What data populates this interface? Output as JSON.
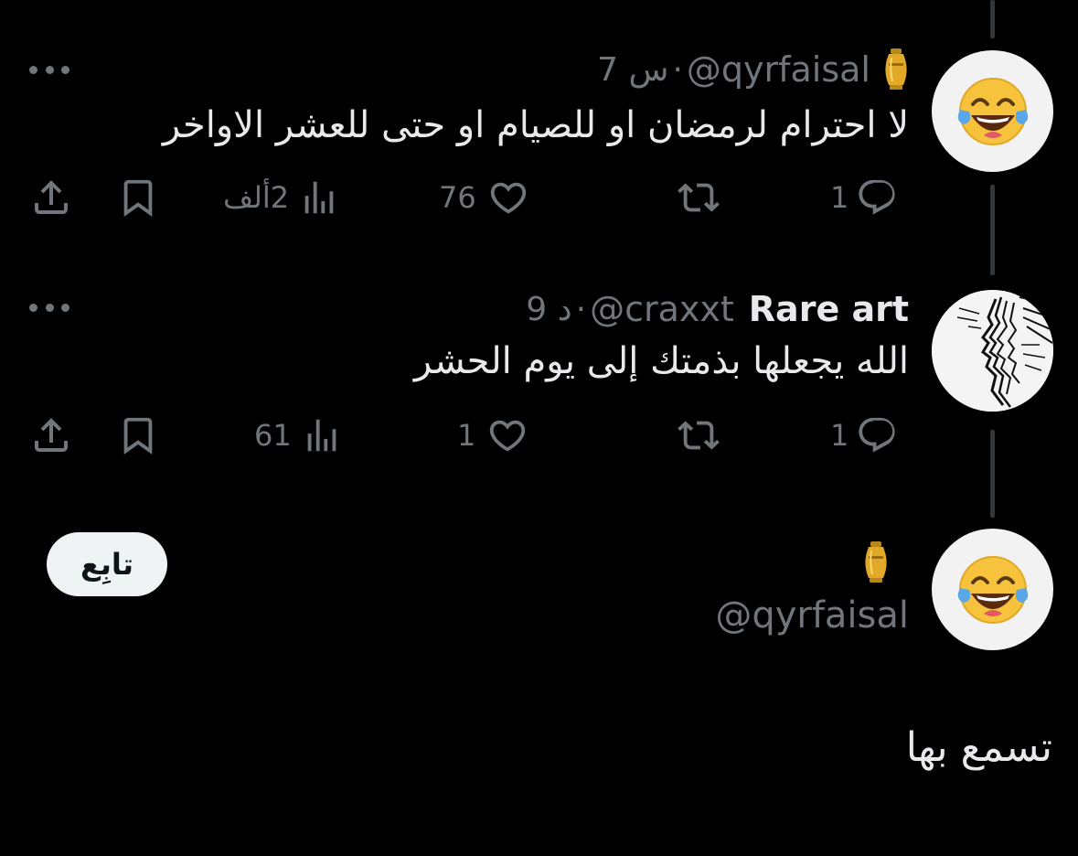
{
  "colors": {
    "background": "#000000",
    "text_primary": "#e7e9ea",
    "text_secondary": "#71767b",
    "thread_line": "#333639",
    "button_bg": "#eff3f4"
  },
  "tweets": [
    {
      "handle": "@qyrfaisal",
      "display_name": "",
      "badge_icon": "urn-icon",
      "time": "7 س",
      "separator": "·",
      "text": "لا احترام لرمضان او للصيام او حتى للعشر الاواخر",
      "avatar_icon": "laughing-tears-emoji-icon",
      "replies": "1",
      "reposts": "",
      "likes": "76",
      "views": "2ألف"
    },
    {
      "handle": "@craxxt",
      "display_name": "Rare art",
      "time": "9 د",
      "separator": "·",
      "text": "الله يجعلها بذمتك إلى يوم الحشر",
      "avatar_icon": "sketch-face-icon",
      "replies": "1",
      "reposts": "",
      "likes": "1",
      "views": "61"
    }
  ],
  "profile": {
    "handle": "@qyrfaisal",
    "badge_icon": "urn-icon",
    "avatar_icon": "laughing-tears-emoji-icon",
    "follow_label": "تابِع"
  },
  "bottom_text": "تسمع بها"
}
